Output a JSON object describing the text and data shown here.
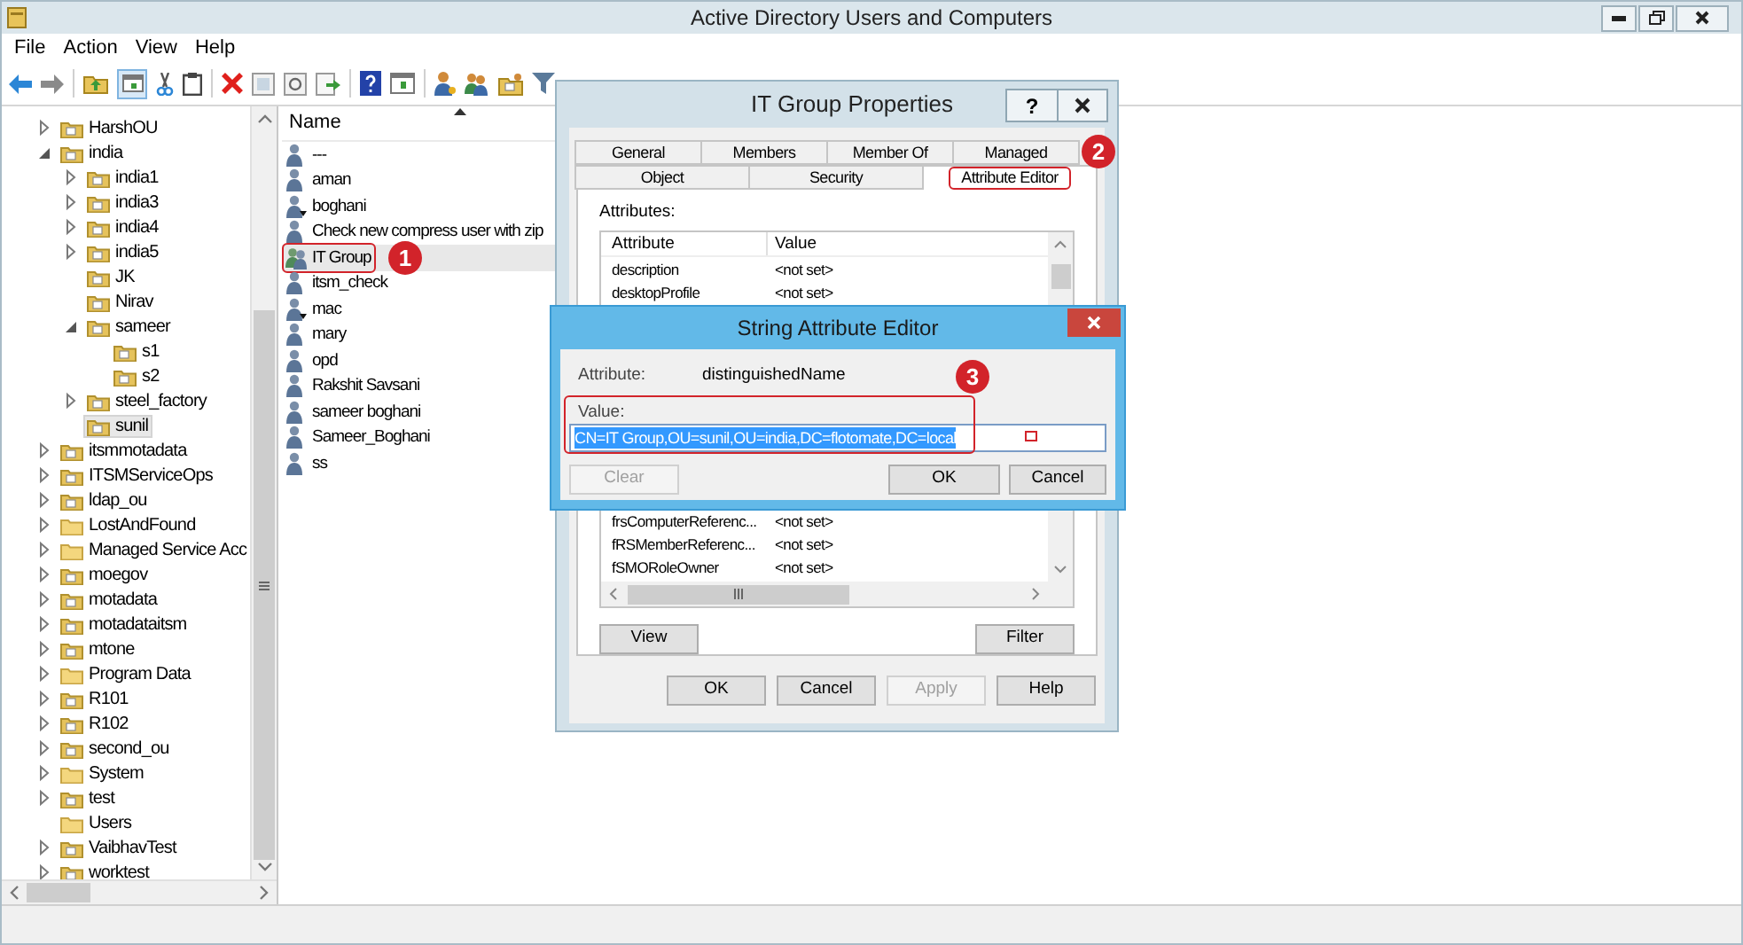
{
  "window": {
    "title": "Active Directory Users and Computers"
  },
  "menu": [
    "File",
    "Action",
    "View",
    "Help"
  ],
  "tree": [
    {
      "label": "HarshOU",
      "kind": "ou",
      "expandable": true,
      "expanded": false,
      "selected": false
    },
    {
      "label": "india",
      "kind": "ou",
      "expandable": true,
      "expanded": true,
      "selected": false,
      "children": [
        {
          "label": "india1",
          "kind": "ou",
          "expandable": true,
          "expanded": false,
          "selected": false
        },
        {
          "label": "india3",
          "kind": "ou",
          "expandable": true,
          "expanded": false,
          "selected": false
        },
        {
          "label": "india4",
          "kind": "ou",
          "expandable": true,
          "expanded": false,
          "selected": false
        },
        {
          "label": "india5",
          "kind": "ou",
          "expandable": true,
          "expanded": false,
          "selected": false
        },
        {
          "label": "JK",
          "kind": "ou",
          "expandable": false,
          "expanded": false,
          "selected": false
        },
        {
          "label": "Nirav",
          "kind": "ou",
          "expandable": false,
          "expanded": false,
          "selected": false
        },
        {
          "label": "sameer",
          "kind": "ou",
          "expandable": true,
          "expanded": true,
          "selected": false,
          "children": [
            {
              "label": "s1",
              "kind": "ou",
              "expandable": false,
              "expanded": false,
              "selected": false
            },
            {
              "label": "s2",
              "kind": "ou",
              "expandable": false,
              "expanded": false,
              "selected": false
            }
          ]
        },
        {
          "label": "steel_factory",
          "kind": "ou",
          "expandable": true,
          "expanded": false,
          "selected": false
        },
        {
          "label": "sunil",
          "kind": "ou",
          "expandable": false,
          "expanded": false,
          "selected": true
        }
      ]
    },
    {
      "label": "itsmmotadata",
      "kind": "ou",
      "expandable": true,
      "expanded": false,
      "selected": false
    },
    {
      "label": "ITSMServiceOps",
      "kind": "ou",
      "expandable": true,
      "expanded": false,
      "selected": false
    },
    {
      "label": "ldap_ou",
      "kind": "ou",
      "expandable": true,
      "expanded": false,
      "selected": false
    },
    {
      "label": "LostAndFound",
      "kind": "container",
      "expandable": true,
      "expanded": false,
      "selected": false
    },
    {
      "label": "Managed Service Acc",
      "kind": "container",
      "expandable": true,
      "expanded": false,
      "selected": false
    },
    {
      "label": "moegov",
      "kind": "ou",
      "expandable": true,
      "expanded": false,
      "selected": false
    },
    {
      "label": "motadata",
      "kind": "ou",
      "expandable": true,
      "expanded": false,
      "selected": false
    },
    {
      "label": "motadataitsm",
      "kind": "ou",
      "expandable": true,
      "expanded": false,
      "selected": false
    },
    {
      "label": "mtone",
      "kind": "ou",
      "expandable": true,
      "expanded": false,
      "selected": false
    },
    {
      "label": "Program Data",
      "kind": "container",
      "expandable": true,
      "expanded": false,
      "selected": false
    },
    {
      "label": "R101",
      "kind": "ou",
      "expandable": true,
      "expanded": false,
      "selected": false
    },
    {
      "label": "R102",
      "kind": "ou",
      "expandable": true,
      "expanded": false,
      "selected": false
    },
    {
      "label": "second_ou",
      "kind": "ou",
      "expandable": true,
      "expanded": false,
      "selected": false
    },
    {
      "label": "System",
      "kind": "container",
      "expandable": true,
      "expanded": false,
      "selected": false
    },
    {
      "label": "test",
      "kind": "ou",
      "expandable": true,
      "expanded": false,
      "selected": false
    },
    {
      "label": "Users",
      "kind": "container",
      "expandable": false,
      "expanded": false,
      "selected": false
    },
    {
      "label": "VaibhavTest",
      "kind": "ou",
      "expandable": true,
      "expanded": false,
      "selected": false
    },
    {
      "label": "worktest",
      "kind": "ou",
      "expandable": true,
      "expanded": false,
      "selected": false
    }
  ],
  "list": {
    "column": "Name",
    "rows": [
      {
        "name": "---",
        "kind": "user",
        "selected": false
      },
      {
        "name": "aman",
        "kind": "user",
        "selected": false
      },
      {
        "name": "boghani",
        "kind": "disabled_user",
        "selected": false
      },
      {
        "name": "Check new compress user with zip",
        "kind": "user",
        "selected": false
      },
      {
        "name": "IT Group",
        "kind": "group",
        "selected": true,
        "callout": "1"
      },
      {
        "name": "itsm_check",
        "kind": "user",
        "selected": false
      },
      {
        "name": "mac",
        "kind": "disabled_user",
        "selected": false
      },
      {
        "name": "mary",
        "kind": "user",
        "selected": false
      },
      {
        "name": "opd",
        "kind": "user",
        "selected": false
      },
      {
        "name": "Rakshit Savsani",
        "kind": "user",
        "selected": false
      },
      {
        "name": "sameer boghani",
        "kind": "user",
        "selected": false
      },
      {
        "name": "Sameer_Boghani",
        "kind": "user",
        "selected": false
      },
      {
        "name": "ss",
        "kind": "user",
        "selected": false
      }
    ]
  },
  "properties_dialog": {
    "title": "IT Group Properties",
    "help_button": "?",
    "tab_rows": [
      [
        {
          "label": "General",
          "selected": false
        },
        {
          "label": "Members",
          "selected": false
        },
        {
          "label": "Member Of",
          "selected": false
        },
        {
          "label": "Managed",
          "selected": false
        }
      ],
      [
        {
          "label": "Object",
          "selected": false
        },
        {
          "label": "Security",
          "selected": false
        },
        {
          "label": "Attribute Editor",
          "selected": true,
          "callout": "2"
        }
      ]
    ],
    "attributes_label": "Attributes:",
    "columns": [
      "Attribute",
      "Value"
    ],
    "rows_above_editor": [
      {
        "attribute": "description",
        "value": "<not set>"
      },
      {
        "attribute": "desktopProfile",
        "value": "<not set>"
      }
    ],
    "rows_below_editor": [
      {
        "attribute": "frsComputerReferenc...",
        "value": "<not set>"
      },
      {
        "attribute": "fRSMemberReferenc...",
        "value": "<not set>"
      },
      {
        "attribute": "fSMORoleOwner",
        "value": "<not set>"
      }
    ],
    "view_button": "View",
    "filter_button": "Filter",
    "buttons": [
      {
        "label": "OK",
        "disabled": false
      },
      {
        "label": "Cancel",
        "disabled": false
      },
      {
        "label": "Apply",
        "disabled": true
      },
      {
        "label": "Help",
        "disabled": false
      }
    ]
  },
  "string_editor": {
    "title": "String Attribute Editor",
    "attribute_label": "Attribute:",
    "attribute": "distinguishedName",
    "value_label": "Value:",
    "value": "CN=IT Group,OU=sunil,OU=india,DC=flotomate,DC=local",
    "value_selected": true,
    "value_callout": "3",
    "buttons": [
      {
        "label": "Clear",
        "disabled": true
      },
      {
        "label": "OK",
        "disabled": false
      },
      {
        "label": "Cancel",
        "disabled": false
      }
    ]
  }
}
